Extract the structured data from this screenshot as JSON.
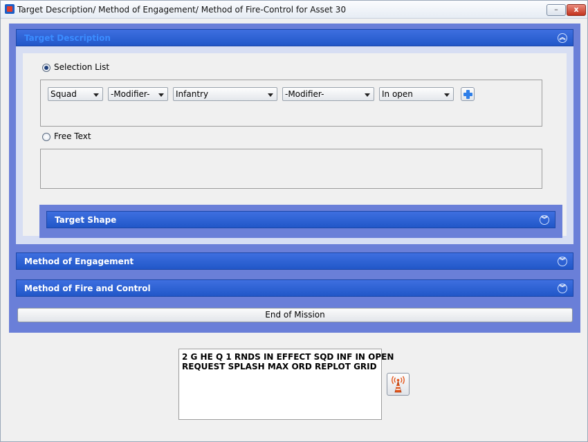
{
  "window": {
    "title": "Target Description/ Method of Engagement/ Method of Fire-Control for Asset 30",
    "min_label": "–",
    "close_label": "x"
  },
  "target_description": {
    "header": "Target Description",
    "selection_list": {
      "label": "Selection List",
      "selected": true,
      "combos": [
        "Squad",
        "-Modifier-",
        "Infantry",
        "-Modifier-",
        "In open"
      ]
    },
    "free_text": {
      "label": "Free Text",
      "selected": false,
      "value": ""
    },
    "target_shape": {
      "header": "Target Shape"
    }
  },
  "method_of_engagement": {
    "header": "Method of Engagement"
  },
  "method_of_fire_control": {
    "header": "Method of Fire and Control"
  },
  "end_of_mission_label": "End of Mission",
  "output": {
    "lines": [
      "2 G HE Q 1 RNDS IN EFFECT SQD INF IN OPEN",
      "REQUEST SPLASH MAX ORD REPLOT GRID"
    ]
  },
  "icons": {
    "collapse": "chevrons-up-icon",
    "expand": "chevrons-down-icon",
    "transmit": "radio-tower-icon",
    "add": "plus-icon"
  }
}
